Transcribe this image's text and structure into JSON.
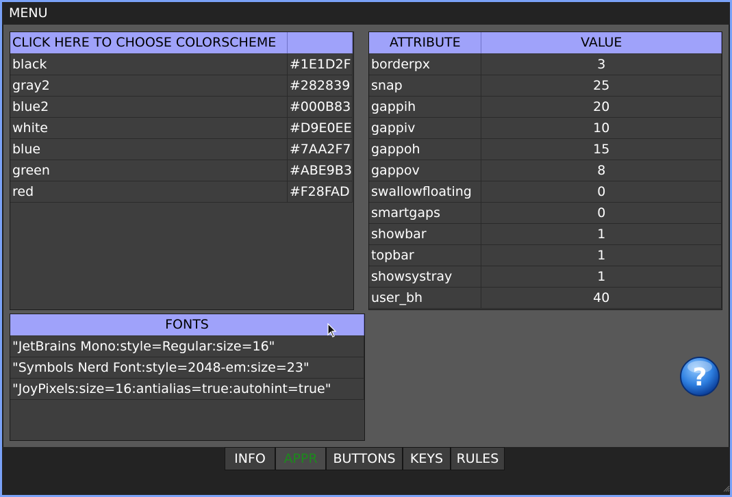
{
  "menu": {
    "title": "MENU"
  },
  "colors": {
    "header": "CLICK HERE TO CHOOSE COLORSCHEME",
    "rows": [
      {
        "name": "black",
        "hex": "#1E1D2F"
      },
      {
        "name": "gray2",
        "hex": "#282839"
      },
      {
        "name": "blue2",
        "hex": "#000B83"
      },
      {
        "name": "white",
        "hex": "#D9E0EE"
      },
      {
        "name": "blue",
        "hex": "#7AA2F7"
      },
      {
        "name": "green",
        "hex": "#ABE9B3"
      },
      {
        "name": "red",
        "hex": "#F28FAD"
      }
    ]
  },
  "attributes": {
    "col_attribute": "ATTRIBUTE",
    "col_value": "VALUE",
    "rows": [
      {
        "attr": "borderpx",
        "value": "3"
      },
      {
        "attr": "snap",
        "value": "25"
      },
      {
        "attr": "gappih",
        "value": "20"
      },
      {
        "attr": "gappiv",
        "value": "10"
      },
      {
        "attr": "gappoh",
        "value": "15"
      },
      {
        "attr": "gappov",
        "value": "8"
      },
      {
        "attr": "swallowfloating",
        "value": "0"
      },
      {
        "attr": "smartgaps",
        "value": "0"
      },
      {
        "attr": "showbar",
        "value": "1"
      },
      {
        "attr": "topbar",
        "value": "1"
      },
      {
        "attr": "showsystray",
        "value": "1"
      },
      {
        "attr": "user_bh",
        "value": "40"
      }
    ]
  },
  "fonts": {
    "header": "FONTS",
    "rows": [
      "\"JetBrains Mono:style=Regular:size=16\"",
      "\"Symbols Nerd Font:style=2048-em:size=23\"",
      "\"JoyPixels:size=16:antialias=true:autohint=true\""
    ]
  },
  "tabs": [
    {
      "label": "INFO",
      "active": false
    },
    {
      "label": "APPR",
      "active": true
    },
    {
      "label": "BUTTONS",
      "active": false
    },
    {
      "label": "KEYS",
      "active": false
    },
    {
      "label": "RULES",
      "active": false
    }
  ],
  "icons": {
    "help": "help-icon",
    "cursor": "mouse-cursor-icon",
    "grip": "resize-grip-icon"
  },
  "palette": {
    "accent": "#9FA2FA",
    "window_border": "#7AA2F7",
    "active_tab": "#1C8A1C"
  }
}
